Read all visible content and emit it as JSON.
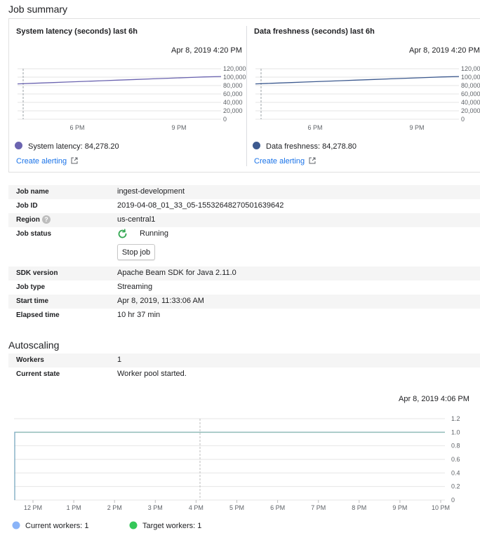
{
  "job_summary": {
    "title": "Job summary",
    "panels": [
      {
        "title": "System latency (seconds) last 6h",
        "timestamp": "Apr 8, 2019 4:20 PM",
        "legend": "System latency: 84,278.20",
        "legend_color": "#6b64b0",
        "link": "Create alerting"
      },
      {
        "title": "Data freshness (seconds) last 6h",
        "timestamp": "Apr 8, 2019 4:20 PM",
        "legend": "Data freshness: 84,278.80",
        "legend_color": "#3d5a8f",
        "link": "Create alerting"
      }
    ]
  },
  "job_info": {
    "job_name_label": "Job name",
    "job_name": "ingest-development",
    "job_id_label": "Job ID",
    "job_id": "2019-04-08_01_33_05-15532648270501639642",
    "region_label": "Region",
    "region": "us-central1",
    "status_label": "Job status",
    "status": "Running",
    "stop_button": "Stop job",
    "sdk_label": "SDK version",
    "sdk": "Apache Beam SDK for Java 2.11.0",
    "type_label": "Job type",
    "type": "Streaming",
    "start_label": "Start time",
    "start": "Apr 8, 2019, 11:33:06 AM",
    "elapsed_label": "Elapsed time",
    "elapsed": "10 hr 37 min"
  },
  "autoscaling": {
    "title": "Autoscaling",
    "workers_label": "Workers",
    "workers": "1",
    "state_label": "Current state",
    "state": "Worker pool started.",
    "timestamp": "Apr 8, 2019 4:06 PM"
  },
  "chart_data": [
    {
      "type": "line",
      "title": "System latency (seconds) last 6h",
      "x_ticks": [
        "6 PM",
        "9 PM"
      ],
      "y_ticks": [
        "0",
        "20,000",
        "40,000",
        "60,000",
        "80,000",
        "100,000",
        "120,000"
      ],
      "ylim": [
        0,
        120000
      ],
      "grid": true,
      "series": [
        {
          "name": "System latency",
          "color": "#6b64b0",
          "values": [
            84000,
            85500,
            87000,
            88500,
            90000,
            91500,
            93000,
            94500,
            96000,
            97500,
            99000,
            100500,
            101500
          ]
        }
      ]
    },
    {
      "type": "line",
      "title": "Data freshness (seconds) last 6h",
      "x_ticks": [
        "6 PM",
        "9 PM"
      ],
      "y_ticks": [
        "0",
        "20,000",
        "40,000",
        "60,000",
        "80,000",
        "100,000",
        "120,000"
      ],
      "ylim": [
        0,
        120000
      ],
      "grid": true,
      "series": [
        {
          "name": "Data freshness",
          "color": "#3d5a8f",
          "values": [
            84000,
            85500,
            87000,
            88500,
            90000,
            91500,
            93000,
            94500,
            96000,
            97500,
            99000,
            100500,
            101500
          ]
        }
      ]
    },
    {
      "type": "line",
      "x_ticks": [
        "12 PM",
        "1 PM",
        "2 PM",
        "3 PM",
        "4 PM",
        "5 PM",
        "6 PM",
        "7 PM",
        "8 PM",
        "9 PM",
        "10 PM"
      ],
      "y_ticks": [
        "0",
        "0.2",
        "0.4",
        "0.6",
        "0.8",
        "1.0",
        "1.2"
      ],
      "ylim": [
        0,
        1.2
      ],
      "grid": true,
      "series": [
        {
          "name": "Current workers",
          "color": "#8ab4f8",
          "value": 1,
          "label": "Current workers: 1"
        },
        {
          "name": "Target workers",
          "color": "#34c759",
          "value": 1,
          "label": "Target workers: 1"
        }
      ]
    }
  ]
}
